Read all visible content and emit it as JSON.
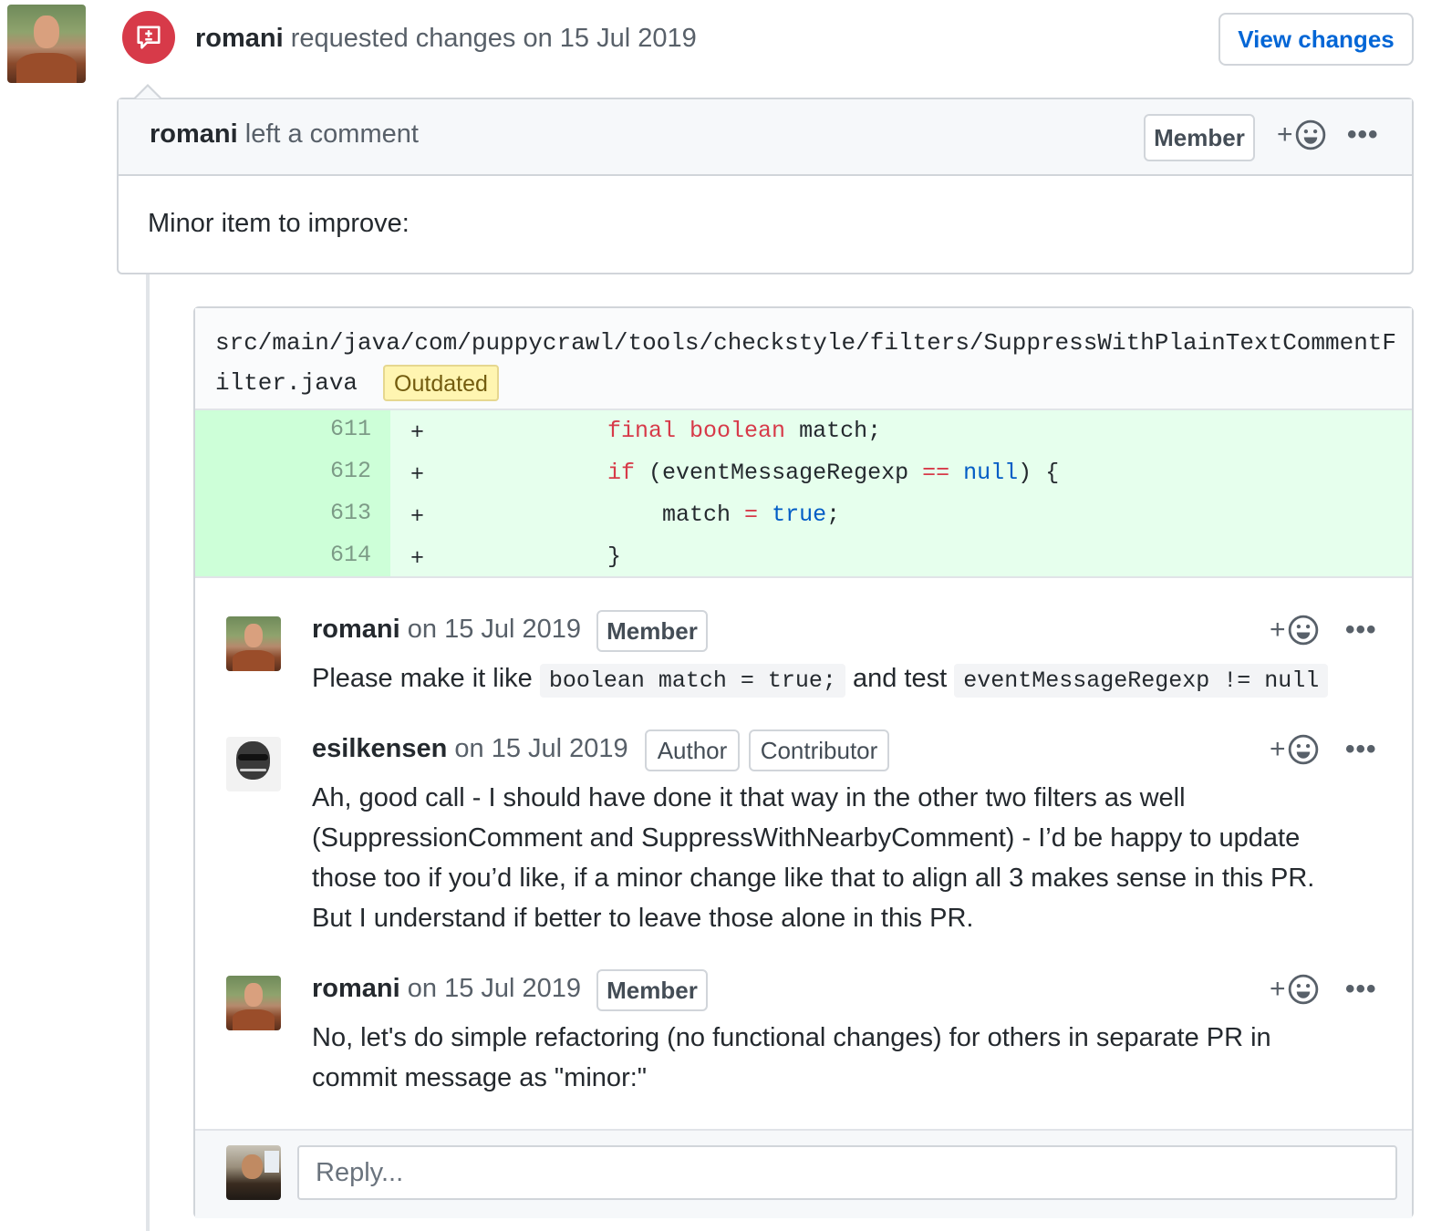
{
  "review": {
    "author": "romani",
    "action_text": "requested changes on 15 Jul 2019",
    "view_changes_label": "View changes"
  },
  "comment": {
    "author": "romani",
    "action_text": "left a comment",
    "badge": "Member",
    "body": "Minor item to improve:"
  },
  "file": {
    "path": "src/main/java/com/puppycrawl/tools/checkstyle/filters/SuppressWithPlainTextCommentFilter.java",
    "status_badge": "Outdated"
  },
  "diff_lines": [
    {
      "num": "611",
      "marker": "+",
      "code": "final boolean match;"
    },
    {
      "num": "612",
      "marker": "+",
      "code": "if (eventMessageRegexp == null) {"
    },
    {
      "num": "613",
      "marker": "+",
      "code": "match = true;"
    },
    {
      "num": "614",
      "marker": "+",
      "code": "}"
    }
  ],
  "review_comments": [
    {
      "author": "romani",
      "date": "on 15 Jul 2019",
      "badges": [
        "Member"
      ],
      "body_parts": [
        "Please make it like",
        "boolean match = true;",
        "and test",
        "eventMessageRegexp != null"
      ]
    },
    {
      "author": "esilkensen",
      "date": "on 15 Jul 2019",
      "badges": [
        "Author",
        "Contributor"
      ],
      "body_lines": [
        "Ah, good call - I should have done it that way in the other two filters as well",
        "(SuppressionComment and SuppressWithNearbyComment) - I’d be happy to update",
        "those too if you’d like, if a minor change like that to align all 3 makes sense in this PR.",
        "But I understand if better to leave those alone in this PR."
      ]
    },
    {
      "author": "romani",
      "date": "on 15 Jul 2019",
      "badges": [
        "Member"
      ],
      "body_lines": [
        "No, let's do simple refactoring (no functional changes) for others in separate PR in",
        "commit message as \"minor:\""
      ]
    }
  ],
  "reaction": {
    "plus": "+",
    "more": "•••"
  },
  "reply": {
    "placeholder": "Reply..."
  },
  "icons": {
    "review": "request-changes-icon",
    "reaction": "smiley-icon",
    "more": "kebab-horizontal-icon"
  },
  "colors": {
    "review_icon_bg": "#d73a49",
    "link": "#0366d6",
    "diff_added_bg": "#e6ffed",
    "diff_gutter_bg": "#cdffd8",
    "outdated_bg": "#fff5b1"
  }
}
